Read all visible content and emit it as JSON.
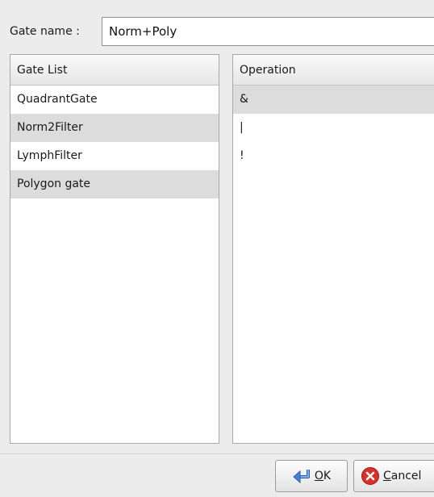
{
  "gate_name": {
    "label": "Gate name :",
    "value": "Norm+Poly"
  },
  "gate_list": {
    "header": "Gate List",
    "items": [
      "QuadrantGate",
      "Norm2Filter",
      "LymphFilter",
      "Polygon gate"
    ]
  },
  "operation_list": {
    "header": "Operation",
    "items": [
      "&",
      "|",
      "!"
    ]
  },
  "buttons": {
    "ok": {
      "mnemonic": "O",
      "rest": "K"
    },
    "cancel": {
      "mnemonic": "C",
      "rest": "ancel"
    }
  },
  "colors": {
    "dialog_bg": "#ececec",
    "row_alt": "#dcdcdc",
    "cancel_icon": "#d9302a",
    "ok_icon": "#4a7fd1"
  },
  "icons": {
    "ok": "ok-arrow-icon",
    "cancel": "cancel-x-icon"
  }
}
